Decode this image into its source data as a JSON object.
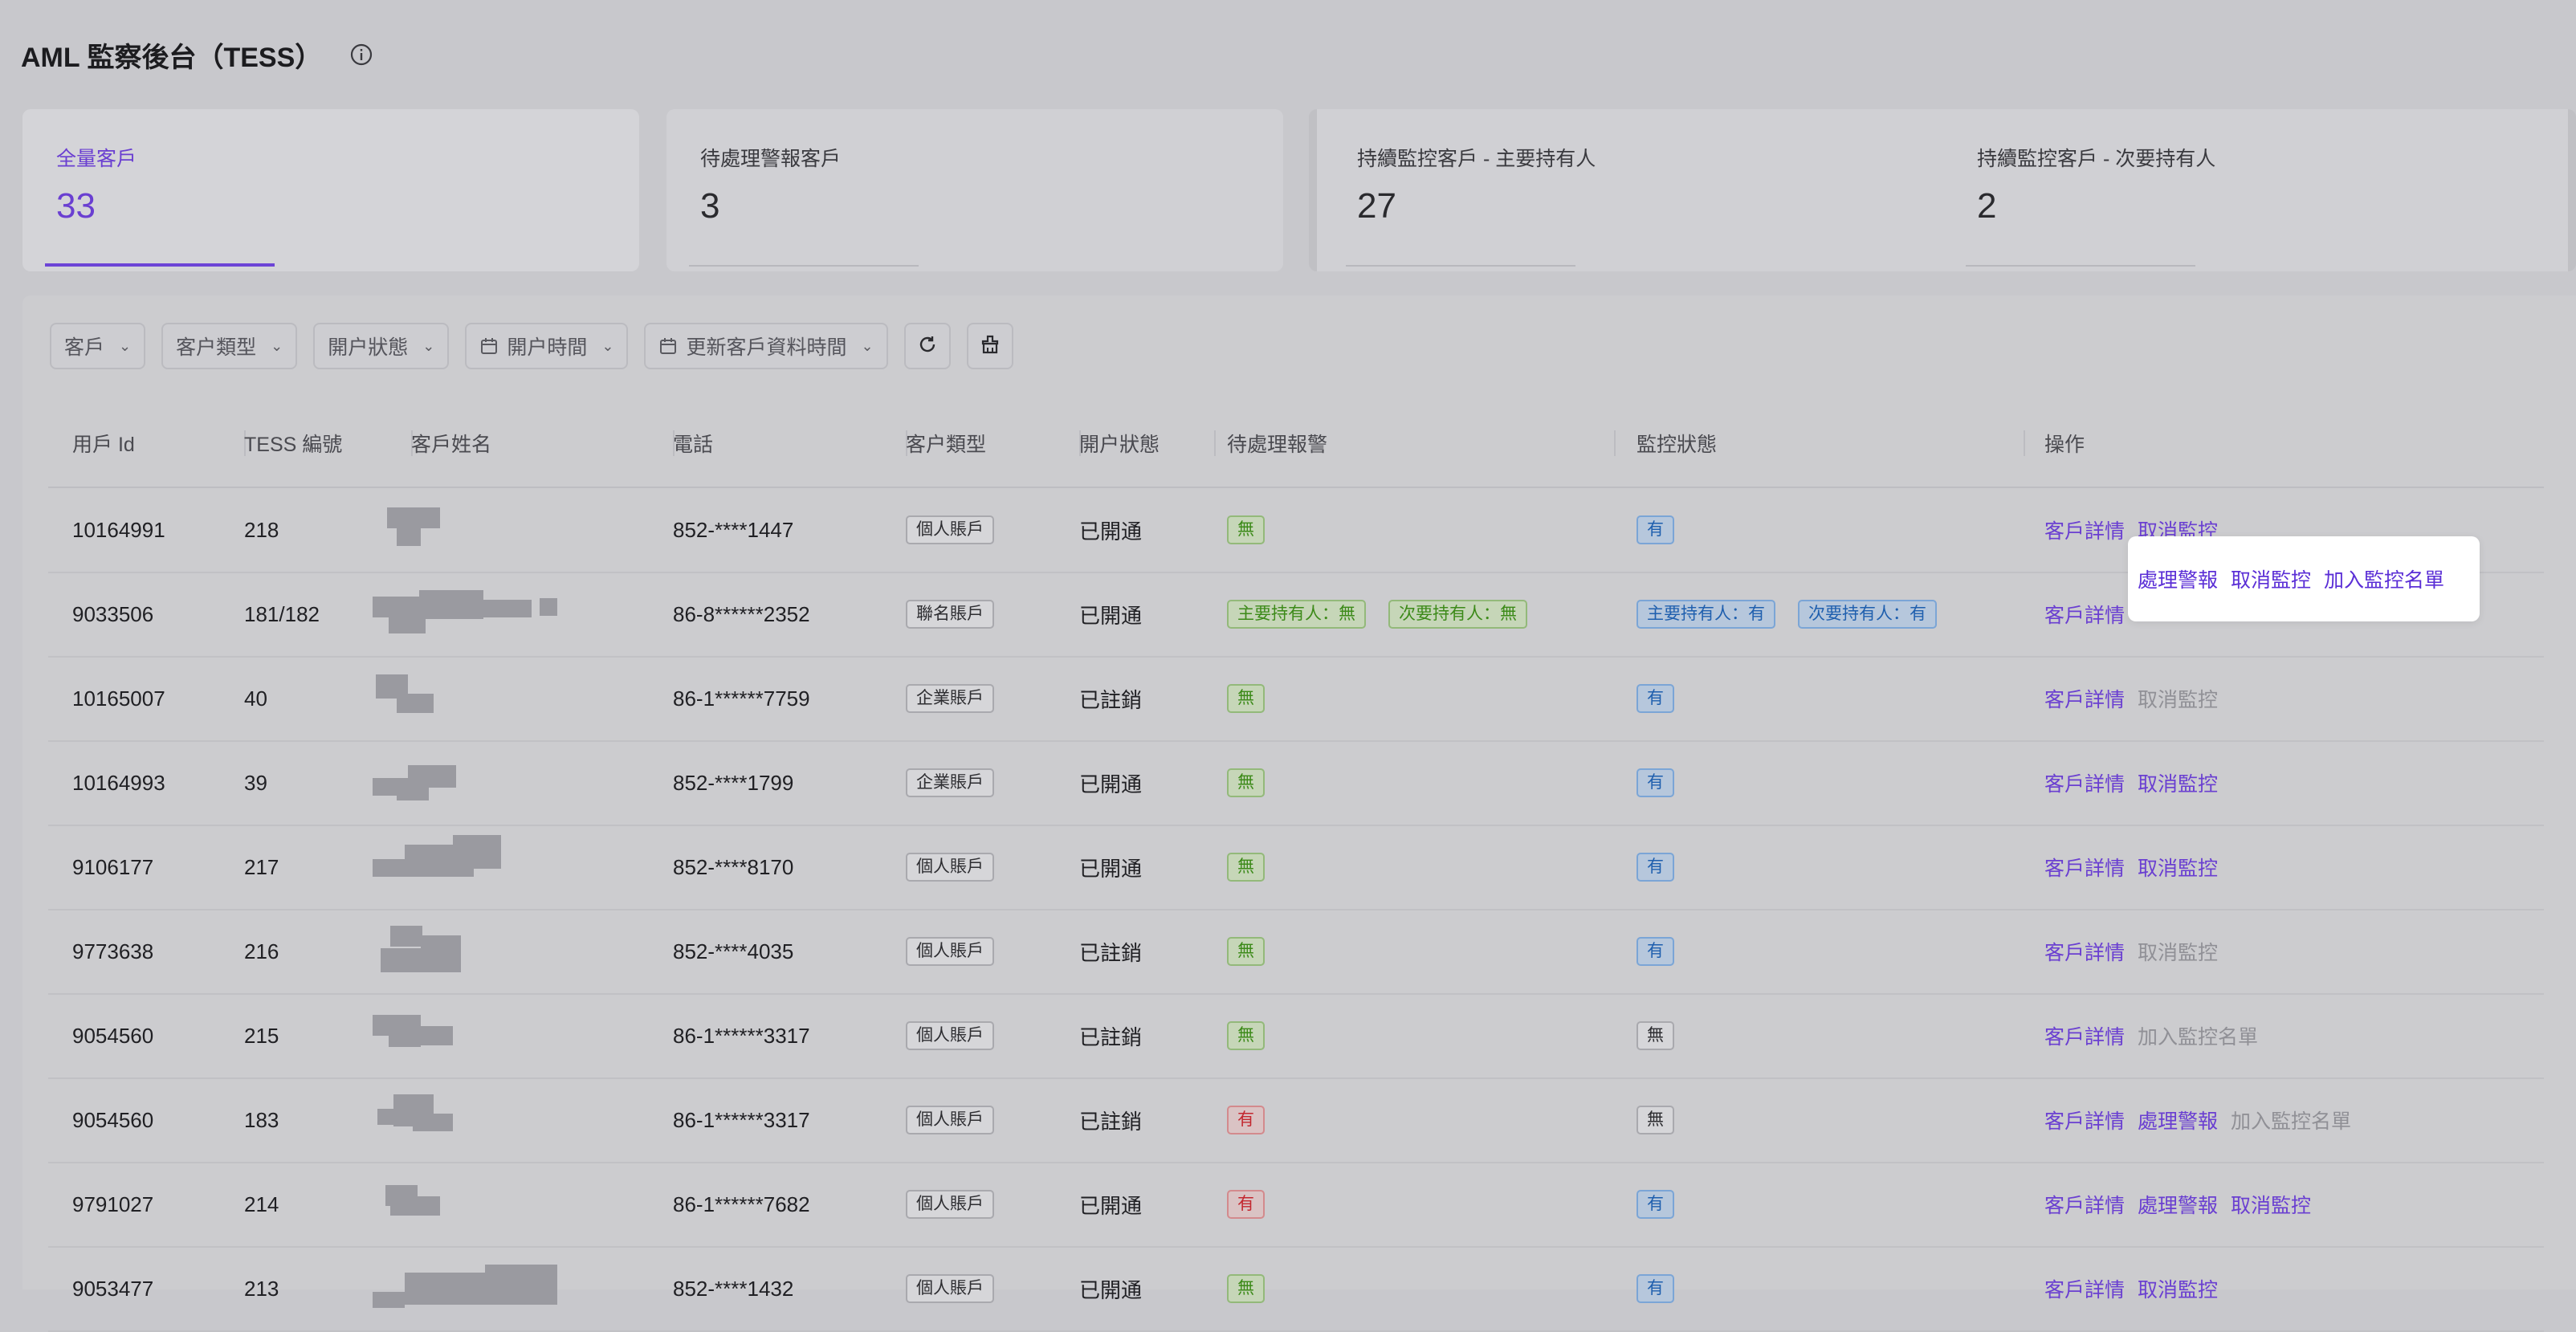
{
  "header": {
    "title": "AML 監察後台（TESS）"
  },
  "stats": [
    {
      "label": "全量客戶",
      "value": "33",
      "active": true
    },
    {
      "label": "待處理警報客戶",
      "value": "3"
    },
    {
      "label": "持續監控客戶 - 主要持有人",
      "value": "27"
    },
    {
      "label": "持續監控客戶 - 次要持有人",
      "value": "2"
    }
  ],
  "filters": {
    "customer": "客戶",
    "customer_type": "客户類型",
    "account_status": "開户狀態",
    "open_time": "開户時間",
    "update_time": "更新客戶資料時間"
  },
  "columns": [
    "用戶 Id",
    "TESS 編號",
    "客戶姓名",
    "電話",
    "客户類型",
    "開户狀態",
    "待處理報警",
    "監控狀態",
    "操作"
  ],
  "rows": [
    {
      "user_id": "10164991",
      "tess_no": "218",
      "phone": "852-****1447",
      "type": "個人賬戶",
      "status": "已開通",
      "alerts": [
        {
          "text": "無",
          "color": "green"
        }
      ],
      "monitor": [
        {
          "text": "有",
          "color": "blue"
        }
      ],
      "actions": [
        {
          "text": "客戶詳情",
          "enabled": true
        },
        {
          "text": "取消監控",
          "enabled": true
        }
      ]
    },
    {
      "user_id": "9033506",
      "tess_no": "181/182",
      "phone": "86-8******2352",
      "type": "聯名賬戶",
      "status": "已開通",
      "alerts": [
        {
          "text": "主要持有人：無",
          "color": "green"
        },
        {
          "text": "次要持有人：無",
          "color": "green"
        }
      ],
      "monitor": [
        {
          "text": "主要持有人：有",
          "color": "blue"
        },
        {
          "text": "次要持有人：有",
          "color": "blue"
        }
      ],
      "actions": [
        {
          "text": "客戶詳情",
          "enabled": true
        }
      ]
    },
    {
      "user_id": "10165007",
      "tess_no": "40",
      "phone": "86-1******7759",
      "type": "企業賬戶",
      "status": "已註銷",
      "alerts": [
        {
          "text": "無",
          "color": "green"
        }
      ],
      "monitor": [
        {
          "text": "有",
          "color": "blue"
        }
      ],
      "actions": [
        {
          "text": "客戶詳情",
          "enabled": true
        },
        {
          "text": "取消監控",
          "enabled": false
        }
      ]
    },
    {
      "user_id": "10164993",
      "tess_no": "39",
      "phone": "852-****1799",
      "type": "企業賬戶",
      "status": "已開通",
      "alerts": [
        {
          "text": "無",
          "color": "green"
        }
      ],
      "monitor": [
        {
          "text": "有",
          "color": "blue"
        }
      ],
      "actions": [
        {
          "text": "客戶詳情",
          "enabled": true
        },
        {
          "text": "取消監控",
          "enabled": true
        }
      ]
    },
    {
      "user_id": "9106177",
      "tess_no": "217",
      "phone": "852-****8170",
      "type": "個人賬戶",
      "status": "已開通",
      "alerts": [
        {
          "text": "無",
          "color": "green"
        }
      ],
      "monitor": [
        {
          "text": "有",
          "color": "blue"
        }
      ],
      "actions": [
        {
          "text": "客戶詳情",
          "enabled": true
        },
        {
          "text": "取消監控",
          "enabled": true
        }
      ]
    },
    {
      "user_id": "9773638",
      "tess_no": "216",
      "phone": "852-****4035",
      "type": "個人賬戶",
      "status": "已註銷",
      "alerts": [
        {
          "text": "無",
          "color": "green"
        }
      ],
      "monitor": [
        {
          "text": "有",
          "color": "blue"
        }
      ],
      "actions": [
        {
          "text": "客戶詳情",
          "enabled": true
        },
        {
          "text": "取消監控",
          "enabled": false
        }
      ]
    },
    {
      "user_id": "9054560",
      "tess_no": "215",
      "phone": "86-1******3317",
      "type": "個人賬戶",
      "status": "已註銷",
      "alerts": [
        {
          "text": "無",
          "color": "green"
        }
      ],
      "monitor": [
        {
          "text": "無",
          "color": "gray"
        }
      ],
      "actions": [
        {
          "text": "客戶詳情",
          "enabled": true
        },
        {
          "text": "加入監控名單",
          "enabled": false
        }
      ]
    },
    {
      "user_id": "9054560",
      "tess_no": "183",
      "phone": "86-1******3317",
      "type": "個人賬戶",
      "status": "已註銷",
      "alerts": [
        {
          "text": "有",
          "color": "red"
        }
      ],
      "monitor": [
        {
          "text": "無",
          "color": "gray"
        }
      ],
      "actions": [
        {
          "text": "客戶詳情",
          "enabled": true
        },
        {
          "text": "處理警報",
          "enabled": true
        },
        {
          "text": "加入監控名單",
          "enabled": false
        }
      ]
    },
    {
      "user_id": "9791027",
      "tess_no": "214",
      "phone": "86-1******7682",
      "type": "個人賬戶",
      "status": "已開通",
      "alerts": [
        {
          "text": "有",
          "color": "red"
        }
      ],
      "monitor": [
        {
          "text": "有",
          "color": "blue"
        }
      ],
      "actions": [
        {
          "text": "客戶詳情",
          "enabled": true
        },
        {
          "text": "處理警報",
          "enabled": true
        },
        {
          "text": "取消監控",
          "enabled": true
        }
      ]
    },
    {
      "user_id": "9053477",
      "tess_no": "213",
      "phone": "852-****1432",
      "type": "個人賬戶",
      "status": "已開通",
      "alerts": [
        {
          "text": "無",
          "color": "green"
        }
      ],
      "monitor": [
        {
          "text": "有",
          "color": "blue"
        }
      ],
      "actions": [
        {
          "text": "客戶詳情",
          "enabled": true
        },
        {
          "text": "取消監控",
          "enabled": true
        }
      ]
    }
  ],
  "popover": {
    "actions": [
      {
        "text": "處理警報",
        "enabled": true
      },
      {
        "text": "取消監控",
        "enabled": true
      },
      {
        "text": "加入監控名單",
        "enabled": true
      }
    ]
  }
}
